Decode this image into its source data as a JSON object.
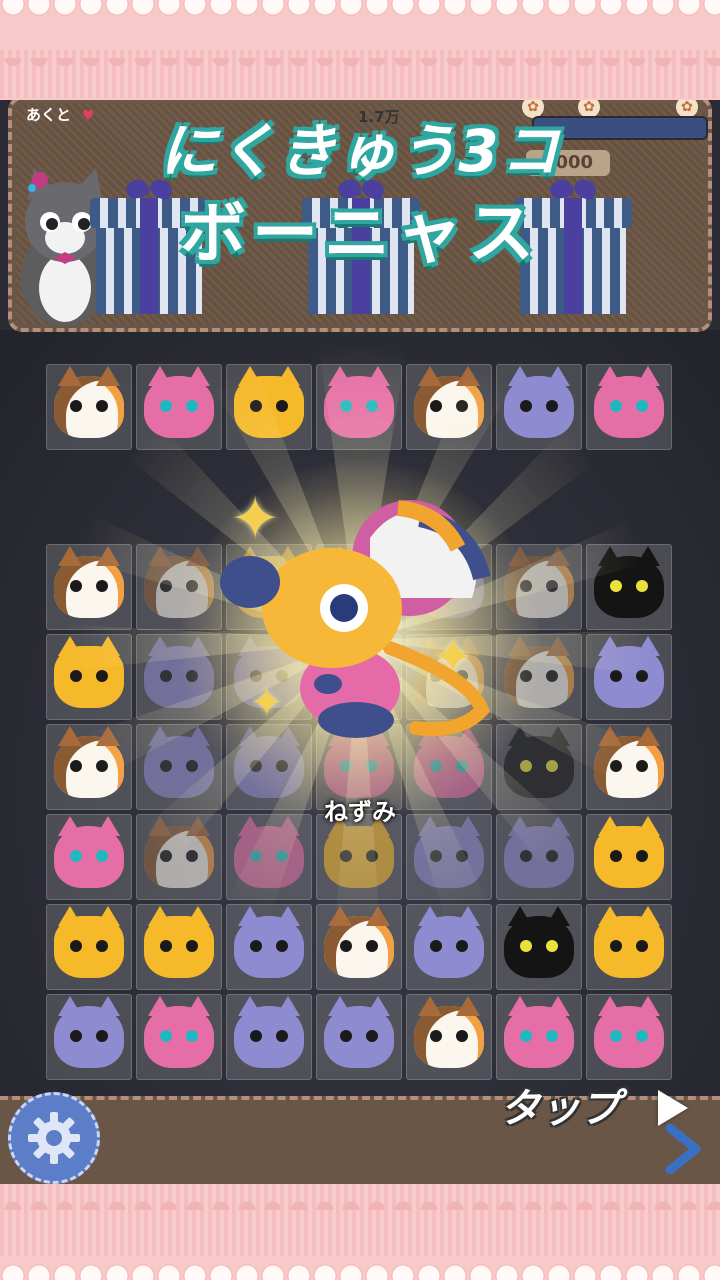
{
  "header": {
    "player_name": "あくと",
    "score_small": "1.7万",
    "score_value": "2000"
  },
  "bonus_title": {
    "line1": "にくきゅう3コ",
    "line2": "ボーニャス"
  },
  "bonus_item": {
    "name": "ねずみ"
  },
  "controls": {
    "tap_label": "タップ"
  },
  "board": {
    "rows": [
      [
        "calico",
        "pink",
        "gold",
        "pink",
        "calico",
        "blue",
        "pink"
      ],
      [
        "calico",
        "calico",
        "gold",
        "gold",
        "blue",
        "calico",
        "black"
      ],
      [
        "gold",
        "blue",
        "blue",
        "blue",
        "calico",
        "calico",
        "blue"
      ],
      [
        "calico",
        "blue",
        "blue",
        "pink",
        "pink",
        "black",
        "calico"
      ],
      [
        "pink",
        "calico",
        "pink",
        "gold",
        "blue",
        "blue",
        "gold"
      ],
      [
        "gold",
        "gold",
        "blue",
        "calico",
        "blue",
        "black",
        "gold"
      ],
      [
        "blue",
        "pink",
        "blue",
        "blue",
        "calico",
        "pink",
        "pink"
      ]
    ]
  },
  "icons": {
    "settings": "gear-icon",
    "paw": "paw-icon",
    "next": "arrow-right-icon"
  },
  "colors": {
    "lace_pink": "#f7c9c9",
    "panel_brown": "#6a5647",
    "title_teal": "#2fa7a0",
    "gear_blue": "#5c7ec9"
  }
}
